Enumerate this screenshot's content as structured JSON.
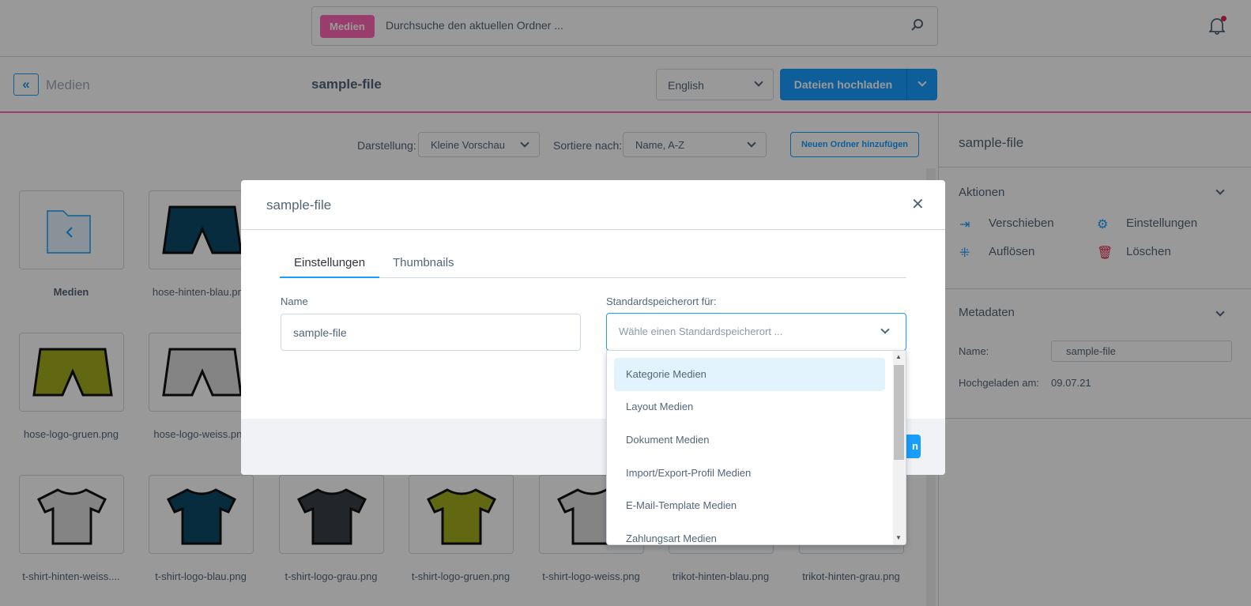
{
  "topbar": {
    "search_badge": "Medien",
    "search_placeholder": "Durchsuche den aktuellen Ordner ..."
  },
  "header": {
    "back_label": "Medien",
    "title": "sample-file",
    "language": "English",
    "upload_label": "Dateien hochladen"
  },
  "toolbar": {
    "view_label": "Darstellung:",
    "view_value": "Kleine Vorschau",
    "sort_label": "Sortiere nach:",
    "sort_value": "Name, A-Z",
    "new_folder_label": "Neuen Ordner hinzufügen"
  },
  "grid": {
    "items": [
      {
        "name": "Medien",
        "type": "folder"
      },
      {
        "name": "hose-hinten-blau.png",
        "type": "shorts",
        "color": "#0a4a66"
      },
      {
        "name": "hose-logo-gruen.png",
        "type": "shorts",
        "color": "#a3ad1f"
      },
      {
        "name": "hose-logo-weiss.png",
        "type": "shorts",
        "color": "#dddddd"
      },
      {
        "name": "t-shirt-hinten-weiss....",
        "type": "shirt",
        "color": "#dddddd"
      },
      {
        "name": "t-shirt-logo-blau.png",
        "type": "shirt",
        "color": "#0a4a66"
      },
      {
        "name": "t-shirt-logo-grau.png",
        "type": "shirt",
        "color": "#3a4047"
      },
      {
        "name": "t-shirt-logo-gruen.png",
        "type": "shirt",
        "color": "#a3ad1f"
      },
      {
        "name": "t-shirt-logo-weiss.png",
        "type": "shirt",
        "color": "#dddddd"
      },
      {
        "name": "trikot-hinten-blau.png",
        "type": "shirt",
        "color": "#0a4a66"
      },
      {
        "name": "trikot-hinten-grau.png",
        "type": "shirt",
        "color": "#3a4047"
      }
    ]
  },
  "sidebar": {
    "title": "sample-file",
    "actions_title": "Aktionen",
    "actions": [
      "Verschieben",
      "Einstellungen",
      "Auflösen",
      "Löschen"
    ],
    "metadata_title": "Metadaten",
    "name_label": "Name:",
    "name_value": "sample-file",
    "uploaded_label": "Hochgeladen am:",
    "uploaded_value": "09.07.21"
  },
  "modal": {
    "title": "sample-file",
    "tabs": [
      "Einstellungen",
      "Thumbnails"
    ],
    "name_label": "Name",
    "name_value": "sample-file",
    "location_label": "Standardspeicherort für:",
    "location_placeholder": "Wähle einen Standardspeicherort ...",
    "footer_button_fragment": "n"
  },
  "dropdown": {
    "options": [
      "Kategorie Medien",
      "Layout Medien",
      "Dokument Medien",
      "Import/Export-Profil Medien",
      "E-Mail-Template Medien",
      "Zahlungsart Medien"
    ],
    "highlighted": 0
  },
  "colors": {
    "accent": "#189eff",
    "media": "#ff68b4",
    "danger": "#de294c"
  }
}
